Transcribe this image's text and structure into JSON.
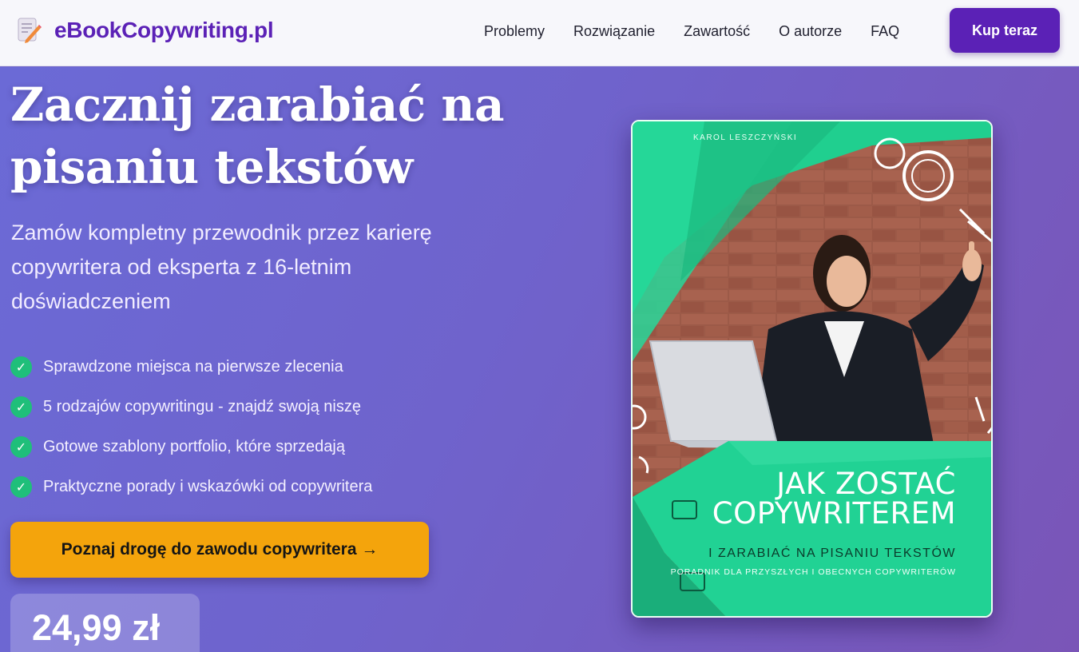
{
  "header": {
    "logo_text": "eBookCopywriting.pl",
    "logo_icon": "memo-pencil-icon",
    "nav": [
      "Problemy",
      "Rozwiązanie",
      "Zawartość",
      "O autorze",
      "FAQ"
    ],
    "buy_label": "Kup teraz"
  },
  "hero": {
    "headline": "Zacznij zarabiać na pisaniu tekstów",
    "subhead": "Zamów kompletny przewodnik przez karierę copywritera od eksperta z 16-letnim doświadczeniem",
    "features": [
      "Sprawdzone miejsca na pierwsze zlecenia",
      "5 rodzajów copywritingu - znajdź swoją niszę",
      "Gotowe szablony portfolio, które sprzedają",
      "Praktyczne porady i wskazówki od copywritera"
    ],
    "check_glyph": "✓",
    "cta_label": "Poznaj drogę do zawodu copywritera →",
    "price": "24,99 zł"
  },
  "book": {
    "author": "KAROL LESZCZYŃSKI",
    "title_line1": "JAK ZOSTAĆ",
    "title_line2": "COPYWRITEREM",
    "subtitle": "I ZARABIAĆ NA PISANIU TEKSTÓW",
    "tagline": "PORADNIK DLA PRZYSZŁYCH I OBECNYCH COPYWRITERÓW"
  },
  "colors": {
    "brand": "#5b21b6",
    "cta": "#f4a40c",
    "check": "#1fbf7a",
    "book_green": "#1fcc8c"
  }
}
